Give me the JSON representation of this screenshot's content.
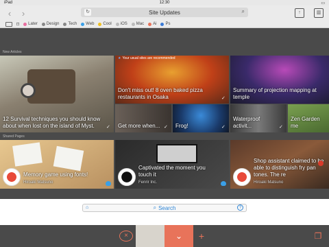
{
  "status": {
    "carrier": "iPad",
    "time": "12:30"
  },
  "toolbar": {
    "title": "Site Updates"
  },
  "tags": [
    {
      "label": "Later",
      "color": "#e86ea0"
    },
    {
      "label": "Design",
      "color": "#888888"
    },
    {
      "label": "Tech",
      "color": "#888888"
    },
    {
      "label": "Web",
      "color": "#3aa0e8"
    },
    {
      "label": "Cool",
      "color": "#f0c020"
    },
    {
      "label": "iOS",
      "color": "#bbbbbb"
    },
    {
      "label": "Mac",
      "color": "#bbbbbb"
    },
    {
      "label": "Ai",
      "color": "#e8735a"
    },
    {
      "label": "Ps",
      "color": "#3a7ad6"
    }
  ],
  "sections": {
    "new": "New Articles",
    "shared": "Shared Pages"
  },
  "recommend": "Your usual sites are recommended",
  "articles": [
    {
      "title": "12 Survival techniques you should know about when lost on the island of Myst."
    },
    {
      "title": "Don't miss out! 8 oven baked pizza restaurants in Osaka"
    },
    {
      "title": "Summary of projection mapping at temple"
    },
    {
      "title": "Get more when..."
    },
    {
      "title": "Frog!"
    },
    {
      "title": "Waterproof activit..."
    },
    {
      "title": "Zen Garden me"
    }
  ],
  "shared": [
    {
      "title": "Memory game using fonts!",
      "author": "Hiroaki Matsuno"
    },
    {
      "title": "Captivated the moment you touch it",
      "author": "Fenrir Inc."
    },
    {
      "title": "Shop assistant claimed to be able to distinguish fry pan tones. The re",
      "author": "Hiroaki Matsuno"
    }
  ],
  "search": {
    "label": "Search"
  },
  "colors": {
    "accent": "#e8735a",
    "link": "#2f86d6"
  }
}
